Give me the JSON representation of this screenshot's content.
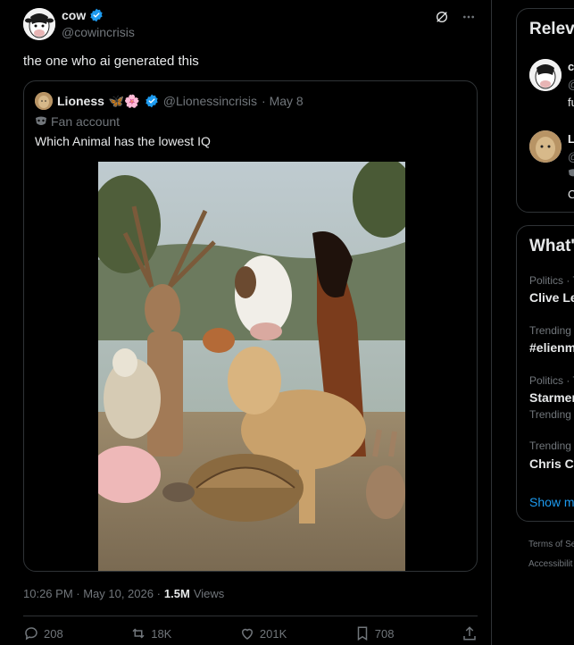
{
  "tweet": {
    "author_name": "cow",
    "author_handle": "@cowincrisis",
    "text": "the one who ai generated this",
    "timestamp": "10:26 PM · May 10, 2026 ·",
    "views_count": "1.5M",
    "views_label": "Views"
  },
  "quote": {
    "author_name": "Lioness",
    "author_emoji": "🦋🌸",
    "author_handle": "@Lionessincrisis",
    "date": "· May 8",
    "label": "Fan account",
    "text": "Which Animal has the lowest IQ"
  },
  "actions": {
    "replies": "208",
    "reposts": "18K",
    "likes": "201K",
    "bookmarks": "708"
  },
  "sidebar": {
    "relevant_title": "Relev",
    "relevant_people": [
      {
        "initial": "c",
        "line2": "@",
        "line3": "fu"
      },
      {
        "initial": "L",
        "line2": "@",
        "line3": "C"
      }
    ],
    "trends_title": "What'",
    "trends": [
      {
        "category": "Politics · T",
        "name": "Clive Le",
        "extra": ""
      },
      {
        "category": "Trending",
        "name": "#elienm",
        "extra": ""
      },
      {
        "category": "Politics · T",
        "name": "Starmer",
        "extra": "Trending"
      },
      {
        "category": "Trending",
        "name": "Chris Cu",
        "extra": ""
      }
    ],
    "show_more": "Show m",
    "footer_terms": "Terms of Se",
    "footer_access": "Accessibilit"
  },
  "colors": {
    "accent": "#1d9bf0",
    "border": "#2f3336",
    "muted": "#71767b",
    "text": "#e7e9ea"
  }
}
